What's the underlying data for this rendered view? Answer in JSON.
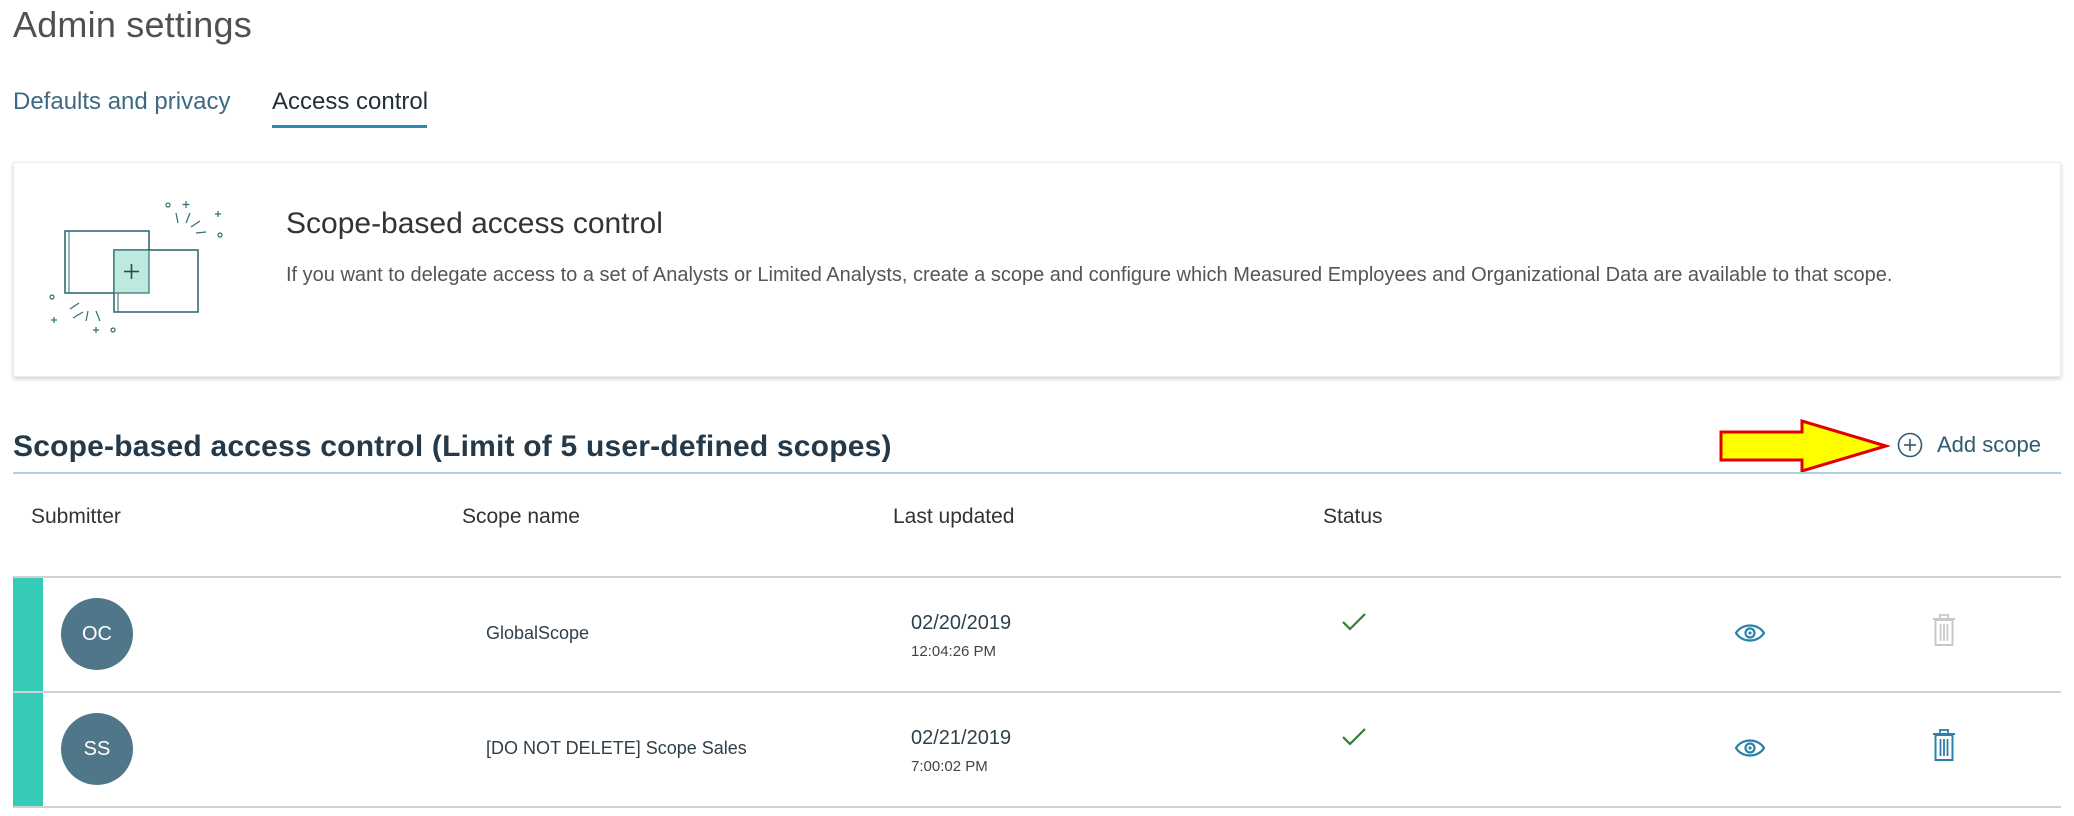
{
  "page": {
    "title": "Admin settings"
  },
  "tabs": [
    {
      "label": "Defaults and privacy",
      "selected": false
    },
    {
      "label": "Access control",
      "selected": true
    }
  ],
  "info_card": {
    "title": "Scope-based access control",
    "description": "If you want to delegate access to a set of Analysts or Limited Analysts, create a scope and configure which Measured Employees and Organizational Data are available to that scope."
  },
  "section": {
    "title": "Scope-based access control (Limit of 5 user-defined scopes)",
    "add_button": "Add scope"
  },
  "table": {
    "headers": {
      "submitter": "Submitter",
      "scope_name": "Scope name",
      "last_updated": "Last updated",
      "status": "Status"
    },
    "rows": [
      {
        "initials": "OC",
        "scope_name": "GlobalScope",
        "date": "02/20/2019",
        "time": "12:04:26 PM",
        "status_icon": "checkmark-icon",
        "delete_enabled": false
      },
      {
        "initials": "SS",
        "scope_name": "[DO NOT DELETE] Scope Sales",
        "date": "02/21/2019",
        "time": "7:00:02 PM",
        "status_icon": "checkmark-icon",
        "delete_enabled": true
      }
    ]
  },
  "colors": {
    "accent": "#36cbb6",
    "link": "#2a8bb0",
    "avatar": "#4f7689",
    "success": "#2e7d32",
    "disabled": "#c8c8c8",
    "annotation_arrow_fill": "#ffff00",
    "annotation_arrow_stroke": "#e00000"
  }
}
